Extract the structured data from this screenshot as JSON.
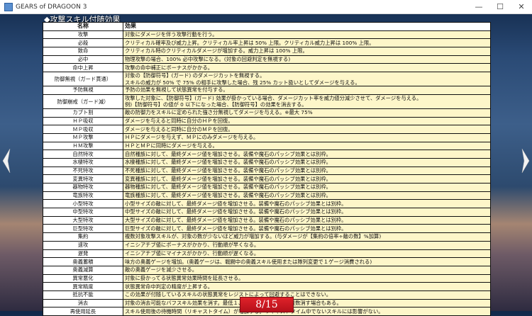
{
  "window": {
    "title": "GEARS of DRAGOON 3",
    "min": "—",
    "max": "☐",
    "close": "✕"
  },
  "heading": "◆攻撃スキル付随効果",
  "table": {
    "headers": [
      "名称",
      "効果"
    ],
    "rows": [
      [
        "攻撃",
        "対象にダメージを伴う攻撃行動を行う。"
      ],
      [
        "必殺",
        "クリティカル確率及び威力上昇。クリティカル率上昇は 50% 上限。クリティカル威力上昇は 100% 上限。"
      ],
      [
        "致命",
        "クリティカル時のクリティカルダメージが増加する。威力上昇は 100% 上限。"
      ],
      [
        "必中",
        "物理攻撃の場合、100% 必中攻撃になる。(対象の回避判定を無視する)"
      ],
      [
        "命中上昇",
        "攻撃の命中補正にボーナスがかかる。"
      ],
      [
        "防御無視（ガード貫通）",
        "対象の【防御符号】(ガード) のダメージカットを無視する。\nスキルの威力が 50% で 75% の相手に攻撃した場合、残 25% カット扱いとしてダメージを与える。"
      ],
      [
        "予防無視",
        "予防の効果を無視して状態異常を付与する。"
      ],
      [
        "防御崩戒（ガード減）",
        "攻撃した対象に、【防御符号】(ガード) 効果が掛かっている場合、ダメージカット率を威力値分減少させて、ダメージを与える。\n例)【防御符号】の値が 0 以下になった場合、【防御符号】の効果を消去する。"
      ],
      [
        "カブト割",
        "敵の防御力をスキルに定められた強さ分無視してダメージを与える。※最大 75%"
      ],
      [
        "ＨＰ吸収",
        "ダメージを与えると同時に自分のＨＰを回復。"
      ],
      [
        "ＭＰ吸収",
        "ダメージを与えると同時に自分のＭＰを回復。"
      ],
      [
        "ＭＰ攻撃",
        "ＨＰにダメージを与えず、ＭＰにのみダメージを与える。"
      ],
      [
        "ＨＭ攻撃",
        "ＨＰとＭＰに同時にダメージを与える。"
      ],
      [
        "自然特攻",
        "自然種族に対して、最終ダメージ値を増加させる。装備や魔石のパッシブ効果とは別枠。"
      ],
      [
        "水棲特攻",
        "水棲種族に対して、最終ダメージ値を増加させる。装備や魔石のパッシブ効果とは別枠。"
      ],
      [
        "不死特攻",
        "不死種族に対して、最終ダメージ値を増加させる。装備や魔石のパッシブ効果とは別枠。"
      ],
      [
        "変異特攻",
        "変異種族に対して、最終ダメージ値を増加させる。装備や魔石のパッシブ効果とは別枠。"
      ],
      [
        "器物特攻",
        "器物種族に対して、最終ダメージ値を増加させる。装備や魔石のパッシブ効果とは別枠。"
      ],
      [
        "竜族特攻",
        "竜族種族に対して、最終ダメージ値を増加させる。装備や魔石のパッシブ効果とは別枠。"
      ],
      [
        "小型特攻",
        "小型サイズの敵に対して、最終ダメージ値を増加させる。装備や魔石のパッシブ効果とは別枠。"
      ],
      [
        "中型特攻",
        "中型サイズの敵に対して、最終ダメージ値を増加させる。装備や魔石のパッシブ効果とは別枠。"
      ],
      [
        "大型特攻",
        "大型サイズの敵に対して、最終ダメージ値を増加させる。装備や魔石のパッシブ効果とは別枠。"
      ],
      [
        "巨型特攻",
        "巨型サイズの敵に対して、最終ダメージ値を増加させる。装備や魔石のパッシブ効果とは別枠。"
      ],
      [
        "集約",
        "複数対象攻撃スキルが、対象の数が少ないほど威力が増加する。(与ダメージが【集約の倍率÷敵の数】%加算)"
      ],
      [
        "速攻",
        "イニシアチブ値にボーナスがかかり、行動順が早くなる。"
      ],
      [
        "遅発",
        "イニシアチブ値にマイナスがかかり、行動順が遅くなる。"
      ],
      [
        "奥義蓄積",
        "味方の奥義ゲージを増加。(奥義ゲージは、戦闘中の奥義スキル使用または隊列変更で１ゲージ消費される)"
      ],
      [
        "奥義減算",
        "敵の奥義ゲージを減少させる。"
      ],
      [
        "異常悪化",
        "対象に掛かってる状態異常効果時間を延長させる。"
      ],
      [
        "異常精度",
        "状態異常命中判定の精度が上昇する。"
      ],
      [
        "抵抗不能",
        "この効果が付随しているスキルの状態異常をレジストによって回避することはできない。"
      ],
      [
        "消去",
        "対象の消去可能なバフスキル効果を消す。最低１、スキルの強さ次第で複数消す場合もある。"
      ],
      [
        "再使用延長",
        "スキル使用後の待機時間（リキャストタイム）が増加する。リキャストタイム中でないスキルには影響がない。"
      ]
    ]
  },
  "pager": {
    "label": "8/15"
  }
}
